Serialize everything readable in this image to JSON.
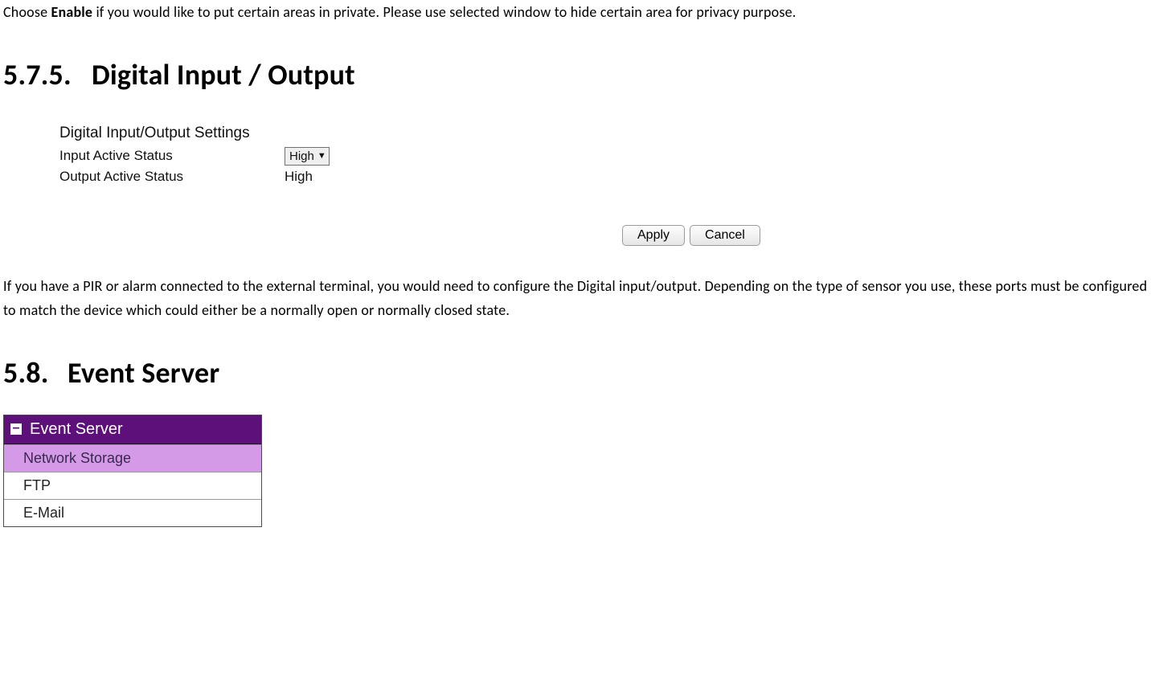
{
  "intro": {
    "prefix": "Choose ",
    "bold": "Enable",
    "suffix": " if you would like to put certain areas in private. Please use selected window to hide certain area for privacy purpose."
  },
  "section_575": {
    "number": "5.7.5.",
    "title": "Digital Input / Output"
  },
  "dio_settings": {
    "heading": "Digital Input/Output Settings",
    "input_label": "Input Active Status",
    "input_value": "High",
    "output_label": "Output Active Status",
    "output_value": "High",
    "apply": "Apply",
    "cancel": "Cancel"
  },
  "dio_desc": "If you have a PIR or alarm connected to the external terminal, you would need to configure the Digital input/output. Depending on the type of sensor you use, these ports must be configured to match the device which could either be a normally open or normally closed state.",
  "section_58": {
    "number": "5.8.",
    "title": "Event Server"
  },
  "event_menu": {
    "header": "Event Server",
    "items": [
      {
        "label": "Network Storage",
        "selected": true
      },
      {
        "label": "FTP",
        "selected": false
      },
      {
        "label": "E-Mail",
        "selected": false
      }
    ]
  }
}
